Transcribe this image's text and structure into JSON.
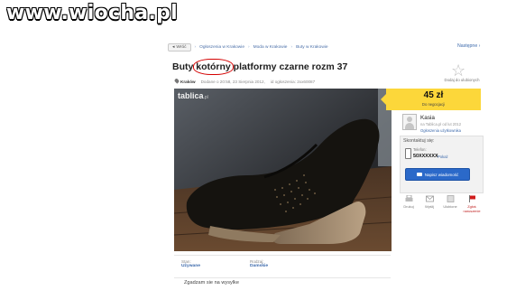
{
  "watermark": "www.wiocha.pl",
  "breadcrumb": {
    "back": "Wróć",
    "items": [
      "Ogłoszenia w Krakowie",
      "Moda w Krakowie",
      "Buty w Krakowie"
    ]
  },
  "nav_next": "Następne",
  "listing": {
    "title_before": "Buty ",
    "title_highlight": "kotórny",
    "title_after": " platformy czarne rozm 37",
    "location": "Kraków",
    "added": "Dodane o 20:58, 23 Sierpnia 2012,",
    "number": "id ogłoszenia: 2xx60087"
  },
  "favorite": {
    "label": "Dodaj do ulubionych",
    "icon": "star-icon"
  },
  "photo": {
    "logo": "tablica",
    "logo_suffix": ".pl",
    "description": "black suede wedge platform shoe"
  },
  "price": {
    "amount": "45 zł",
    "negotiable": "Do negocjacji"
  },
  "seller": {
    "name": "Kasia",
    "since": "na Tablica.pl od lut 2012",
    "other_ads": "Ogłoszenia użytkownika"
  },
  "contact": {
    "label": "Skontaktuj się:",
    "phone_label": "Telefon:",
    "phone_value": "50XXXXXX",
    "phone_show": "Pokaż",
    "message_button": "Napisz wiadomość"
  },
  "actions": [
    {
      "label": "Drukuj",
      "icon": "print-icon"
    },
    {
      "label": "Wyślij",
      "icon": "mail-icon"
    },
    {
      "label": "Ulubione",
      "icon": "favorite-icon"
    },
    {
      "label": "Zgłoś naruszenie",
      "icon": "flag-icon"
    }
  ],
  "details": [
    {
      "label": "Stan:",
      "value": "Używane"
    },
    {
      "label": "Rodzaj:",
      "value": "Damskie"
    }
  ],
  "description": "Zgadzam sie na wysylke",
  "colors": {
    "link": "#3d6aac",
    "price_bg": "#fcd73a",
    "button": "#2b69c9",
    "highlight": "#d40000"
  }
}
